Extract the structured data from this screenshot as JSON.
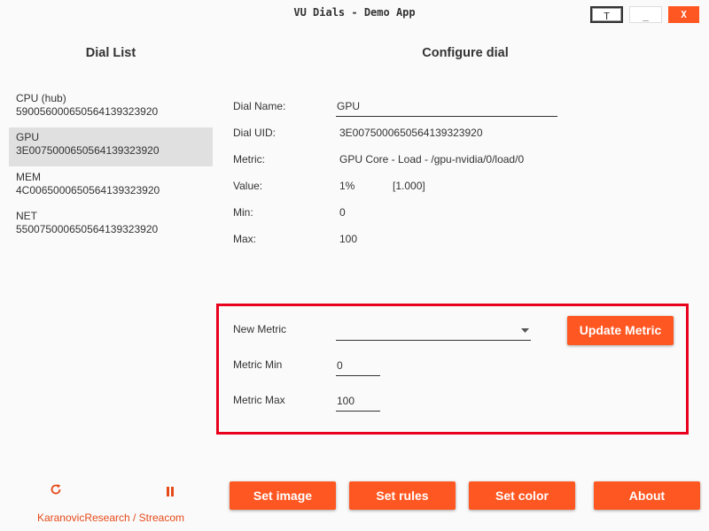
{
  "window": {
    "title": "VU Dials - Demo App",
    "buttons": {
      "t": "T",
      "minimize": "_",
      "close": "X"
    }
  },
  "dial_list": {
    "heading": "Dial List",
    "items": [
      {
        "name": "CPU (hub)",
        "uid": "590056000650564139323920",
        "selected": false
      },
      {
        "name": "GPU",
        "uid": "3E0075000650564139323920",
        "selected": true
      },
      {
        "name": "MEM",
        "uid": "4C0065000650564139323920",
        "selected": false
      },
      {
        "name": "NET",
        "uid": "550075000650564139323920",
        "selected": false
      }
    ]
  },
  "configure": {
    "heading": "Configure dial",
    "dial_name_label": "Dial Name:",
    "dial_name_value": "GPU",
    "dial_uid_label": "Dial UID:",
    "dial_uid_value": "3E0075000650564139323920",
    "metric_label": "Metric:",
    "metric_value": "GPU Core - Load - /gpu-nvidia/0/load/0",
    "value_label": "Value:",
    "value_percent": "1%",
    "value_raw": "[1.000]",
    "min_label": "Min:",
    "min_value": "0",
    "max_label": "Max:",
    "max_value": "100"
  },
  "metric_panel": {
    "new_metric_label": "New Metric",
    "new_metric_value": "",
    "metric_min_label": "Metric Min",
    "metric_min_value": "0",
    "metric_max_label": "Metric Max",
    "metric_max_value": "100",
    "update_button": "Update Metric"
  },
  "bottom_buttons": {
    "set_image": "Set image",
    "set_rules": "Set rules",
    "set_color": "Set color",
    "about": "About"
  },
  "footer": {
    "refresh_icon": "refresh-icon",
    "pause_icon": "pause-icon",
    "brand": "KaranovicResearch / Streacom"
  },
  "colors": {
    "accent": "#ff5722",
    "highlight_border": "#e8001c",
    "selected_bg": "#e0e0e0"
  }
}
